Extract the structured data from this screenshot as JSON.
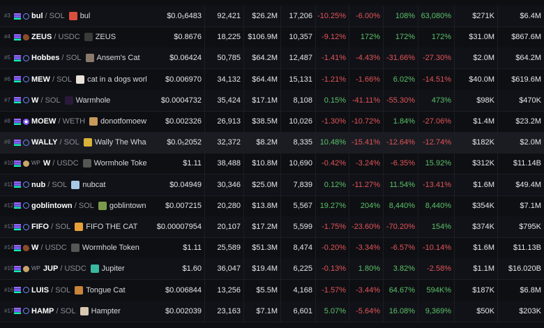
{
  "rows": [
    {
      "rank": "#3",
      "dex": "plain",
      "wp": "",
      "symbol": "bul",
      "quote": "SOL",
      "token_name": "bul",
      "logo_color": "#d94f3d",
      "price_main": "$0.0",
      "price_sub": "5",
      "price_rest": "6483",
      "txns": "92,421",
      "volume": "$26.2M",
      "makers": "17,206",
      "m5": "-10.25%",
      "h1": "-6.00%",
      "h6": "108%",
      "h24": "63,080%",
      "liquidity": "$271K",
      "mcap": "$6.4M"
    },
    {
      "rank": "#4",
      "dex": "meteor",
      "wp": "",
      "symbol": "ZEUS",
      "quote": "USDC",
      "token_name": "ZEUS",
      "logo_color": "#3a3a3a",
      "price_main": "$0.8676",
      "price_sub": "",
      "price_rest": "",
      "txns": "18,225",
      "volume": "$106.9M",
      "makers": "10,357",
      "m5": "-9.12%",
      "h1": "172%",
      "h6": "172%",
      "h24": "172%",
      "liquidity": "$31.0M",
      "mcap": "$867.6M"
    },
    {
      "rank": "#5",
      "dex": "plain",
      "wp": "",
      "symbol": "Hobbes",
      "quote": "SOL",
      "token_name": "Ansem's Cat",
      "logo_color": "#8a7a6a",
      "price_main": "$0.06424",
      "price_sub": "",
      "price_rest": "",
      "txns": "50,785",
      "volume": "$64.2M",
      "makers": "12,487",
      "m5": "-1.41%",
      "h1": "-4.43%",
      "h6": "-31.66%",
      "h24": "-27.30%",
      "liquidity": "$2.0M",
      "mcap": "$64.2M"
    },
    {
      "rank": "#6",
      "dex": "plain",
      "wp": "",
      "symbol": "MEW",
      "quote": "SOL",
      "token_name": "cat in a dogs world",
      "logo_color": "#e8e2dc",
      "price_main": "$0.006970",
      "price_sub": "",
      "price_rest": "",
      "txns": "34,132",
      "volume": "$64.4M",
      "makers": "15,131",
      "m5": "-1.21%",
      "h1": "-1.66%",
      "h6": "6.02%",
      "h24": "-14.51%",
      "liquidity": "$40.0M",
      "mcap": "$619.6M"
    },
    {
      "rank": "#7",
      "dex": "plain",
      "wp": "",
      "symbol": "W",
      "quote": "SOL",
      "token_name": "Warmhole",
      "logo_color": "#2a1a3a",
      "price_main": "$0.0004732",
      "price_sub": "",
      "price_rest": "",
      "txns": "35,424",
      "volume": "$17.1M",
      "makers": "8,108",
      "m5": "0.15%",
      "h1": "-41.11%",
      "h6": "-55.30%",
      "h24": "473%",
      "liquidity": "$98K",
      "mcap": "$470K"
    },
    {
      "rank": "#8",
      "dex": "raydium",
      "wp": "",
      "symbol": "MOEW",
      "quote": "WETH",
      "token_name": "donotfomoew",
      "logo_color": "#c79a5a",
      "price_main": "$0.002326",
      "price_sub": "",
      "price_rest": "",
      "txns": "26,913",
      "volume": "$38.5M",
      "makers": "10,026",
      "m5": "-1.30%",
      "h1": "-10.72%",
      "h6": "1.84%",
      "h24": "-27.06%",
      "liquidity": "$1.4M",
      "mcap": "$23.2M"
    },
    {
      "rank": "#9",
      "dex": "plain",
      "wp": "",
      "symbol": "WALLY",
      "quote": "SOL",
      "token_name": "Wally The Whale",
      "logo_color": "#d9b23a",
      "price_main": "$0.0",
      "price_sub": "5",
      "price_rest": "2052",
      "txns": "32,372",
      "volume": "$8.2M",
      "makers": "8,335",
      "m5": "10.48%",
      "h1": "-15.41%",
      "h6": "-12.64%",
      "h24": "-12.74%",
      "liquidity": "$182K",
      "mcap": "$2.0M"
    },
    {
      "rank": "#10",
      "dex": "alt",
      "wp": "WP",
      "symbol": "W",
      "quote": "USDC",
      "token_name": "Wormhole Token",
      "logo_color": "",
      "price_main": "$1.11",
      "price_sub": "",
      "price_rest": "",
      "txns": "38,488",
      "volume": "$10.8M",
      "makers": "10,690",
      "m5": "-0.42%",
      "h1": "-3.24%",
      "h6": "-6.35%",
      "h24": "15.92%",
      "liquidity": "$312K",
      "mcap": "$11.14B"
    },
    {
      "rank": "#11",
      "dex": "plain",
      "wp": "",
      "symbol": "nub",
      "quote": "SOL",
      "token_name": "nubcat",
      "logo_color": "#a8c8e8",
      "price_main": "$0.04949",
      "price_sub": "",
      "price_rest": "",
      "txns": "30,346",
      "volume": "$25.0M",
      "makers": "7,839",
      "m5": "0.12%",
      "h1": "-11.27%",
      "h6": "11.54%",
      "h24": "-13.41%",
      "liquidity": "$1.6M",
      "mcap": "$49.4M"
    },
    {
      "rank": "#12",
      "dex": "plain",
      "wp": "",
      "symbol": "goblintown",
      "quote": "SOL",
      "token_name": "goblintown",
      "logo_color": "#7a9a4a",
      "price_main": "$0.007215",
      "price_sub": "",
      "price_rest": "",
      "txns": "20,280",
      "volume": "$13.8M",
      "makers": "5,567",
      "m5": "19.27%",
      "h1": "204%",
      "h6": "8,440%",
      "h24": "8,440%",
      "liquidity": "$354K",
      "mcap": "$7.1M"
    },
    {
      "rank": "#13",
      "dex": "plain",
      "wp": "",
      "symbol": "FIFO",
      "quote": "SOL",
      "token_name": "FIFO THE CAT",
      "logo_color": "#e8a03a",
      "price_main": "$0.00007954",
      "price_sub": "",
      "price_rest": "",
      "txns": "20,107",
      "volume": "$17.2M",
      "makers": "5,599",
      "m5": "-1.75%",
      "h1": "-23.60%",
      "h6": "-70.20%",
      "h24": "154%",
      "liquidity": "$374K",
      "mcap": "$795K"
    },
    {
      "rank": "#14",
      "dex": "meteor",
      "wp": "",
      "symbol": "W",
      "quote": "USDC",
      "token_name": "Wormhole Token",
      "logo_color": "",
      "price_main": "$1.11",
      "price_sub": "",
      "price_rest": "",
      "txns": "25,589",
      "volume": "$51.3M",
      "makers": "8,474",
      "m5": "-0.20%",
      "h1": "-3.34%",
      "h6": "-6.57%",
      "h24": "-10.14%",
      "liquidity": "$1.6M",
      "mcap": "$11.13B"
    },
    {
      "rank": "#15",
      "dex": "alt",
      "wp": "WP",
      "symbol": "JUP",
      "quote": "USDC",
      "token_name": "Jupiter",
      "logo_color": "#3ab8a0",
      "price_main": "$1.60",
      "price_sub": "",
      "price_rest": "",
      "txns": "36,047",
      "volume": "$19.4M",
      "makers": "6,225",
      "m5": "-0.13%",
      "h1": "1.80%",
      "h6": "3.82%",
      "h24": "-2.58%",
      "liquidity": "$1.1M",
      "mcap": "$16.020B"
    },
    {
      "rank": "#16",
      "dex": "plain",
      "wp": "",
      "symbol": "LUIS",
      "quote": "SOL",
      "token_name": "Tongue Cat",
      "logo_color": "#c8843a",
      "price_main": "$0.006844",
      "price_sub": "",
      "price_rest": "",
      "txns": "13,256",
      "volume": "$5.5M",
      "makers": "4,168",
      "m5": "-1.57%",
      "h1": "-3.44%",
      "h6": "64.67%",
      "h24": "594K%",
      "liquidity": "$187K",
      "mcap": "$6.8M"
    },
    {
      "rank": "#17",
      "dex": "plain",
      "wp": "",
      "symbol": "HAMP",
      "quote": "SOL",
      "token_name": "Hampter",
      "logo_color": "#d8c8b0",
      "price_main": "$0.002039",
      "price_sub": "",
      "price_rest": "",
      "txns": "23,163",
      "volume": "$7.1M",
      "makers": "6,601",
      "m5": "5.07%",
      "h1": "-5.64%",
      "h6": "16.08%",
      "h24": "9,369%",
      "liquidity": "$50K",
      "mcap": "$203K"
    }
  ]
}
